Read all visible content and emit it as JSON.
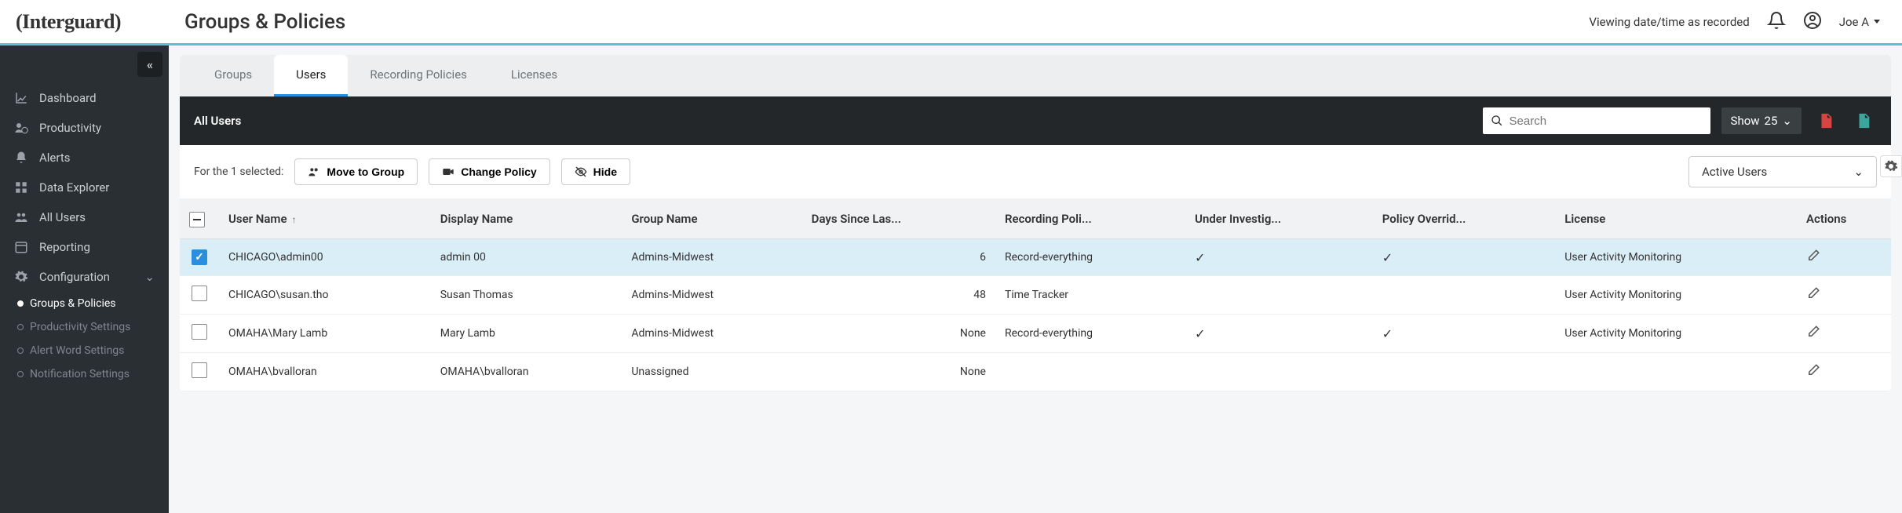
{
  "logo": "(Interguard)",
  "page_title": "Groups & Policies",
  "viewing_text": "Viewing date/time as recorded",
  "user_name": "Joe A",
  "sidebar": {
    "items": [
      {
        "label": "Dashboard"
      },
      {
        "label": "Productivity"
      },
      {
        "label": "Alerts"
      },
      {
        "label": "Data Explorer"
      },
      {
        "label": "All Users"
      },
      {
        "label": "Reporting"
      },
      {
        "label": "Configuration"
      }
    ],
    "config_children": [
      {
        "label": "Groups & Policies",
        "active": true
      },
      {
        "label": "Productivity Settings"
      },
      {
        "label": "Alert Word Settings"
      },
      {
        "label": "Notification Settings"
      }
    ]
  },
  "tabs": [
    {
      "label": "Groups"
    },
    {
      "label": "Users",
      "active": true
    },
    {
      "label": "Recording Policies"
    },
    {
      "label": "Licenses"
    }
  ],
  "panel": {
    "title": "All Users",
    "search_placeholder": "Search",
    "show_label": "Show",
    "show_value": "25"
  },
  "toolbar": {
    "selected_text": "For the 1 selected:",
    "move_group": "Move to Group",
    "change_policy": "Change Policy",
    "hide": "Hide",
    "filter_label": "Active Users"
  },
  "columns": {
    "user_name": "User Name",
    "display_name": "Display Name",
    "group_name": "Group Name",
    "days_since": "Days Since Las...",
    "recording_policy": "Recording Poli...",
    "under_investigation": "Under Investig...",
    "policy_override": "Policy Overrid...",
    "license": "License",
    "actions": "Actions"
  },
  "rows": [
    {
      "selected": true,
      "user_name": "CHICAGO\\admin00",
      "display_name": "admin 00",
      "group": "Admins-Midwest",
      "days": "6",
      "policy": "Record-everything",
      "investigation": "✓",
      "override": "✓",
      "license": "User Activity Monitoring"
    },
    {
      "selected": false,
      "user_name": "CHICAGO\\susan.tho",
      "display_name": "Susan Thomas",
      "group": "Admins-Midwest",
      "days": "48",
      "policy": "Time Tracker",
      "investigation": "",
      "override": "",
      "license": "User Activity Monitoring"
    },
    {
      "selected": false,
      "user_name": "OMAHA\\Mary Lamb",
      "display_name": "Mary Lamb",
      "group": "Admins-Midwest",
      "days": "None",
      "policy": "Record-everything",
      "investigation": "✓",
      "override": "✓",
      "license": "User Activity Monitoring"
    },
    {
      "selected": false,
      "user_name": "OMAHA\\bvalloran",
      "display_name": "OMAHA\\bvalloran",
      "group": "Unassigned",
      "days": "None",
      "policy": "",
      "investigation": "",
      "override": "",
      "license": ""
    }
  ]
}
